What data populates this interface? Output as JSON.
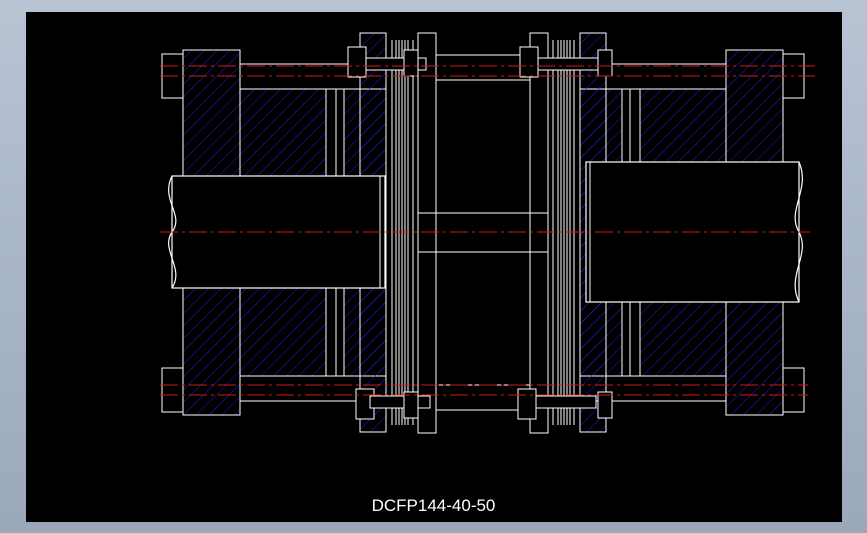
{
  "drawing": {
    "label": "DCFP144-40-50"
  },
  "colors": {
    "background": "#000000",
    "outline": "#ffffff",
    "hatch": "#1e1ee0",
    "centerline": "#d01818",
    "window": "#a6b2c4"
  }
}
